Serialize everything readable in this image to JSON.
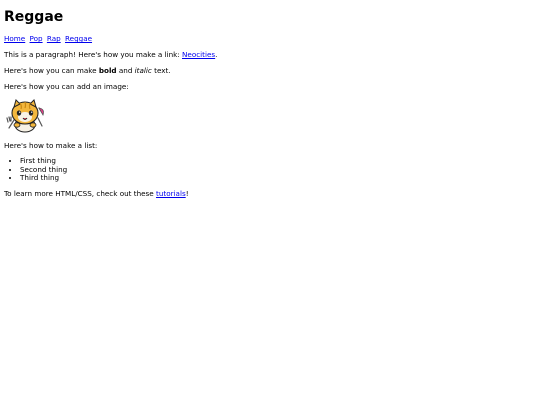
{
  "page_title": "Reggae",
  "nav": {
    "items": [
      "Home",
      "Pop",
      "Rap",
      "Reggae"
    ]
  },
  "para_link": {
    "before": "This is a paragraph! Here's how you make a link: ",
    "link_text": "Neocities",
    "after": "."
  },
  "para_format": {
    "before": "Here's how you can make ",
    "bold": "bold",
    "middle": " and ",
    "italic": "italic",
    "after": " text."
  },
  "para_image": "Here's how you can add an image:",
  "image": {
    "icon": "neocities-cat-mascot-icon"
  },
  "para_list": "Here's how to make a list:",
  "list_items": [
    "First thing",
    "Second thing",
    "Third thing"
  ],
  "para_learn": {
    "before": "To learn more HTML/CSS, check out these ",
    "link_text": "tutorials",
    "after": "!"
  }
}
